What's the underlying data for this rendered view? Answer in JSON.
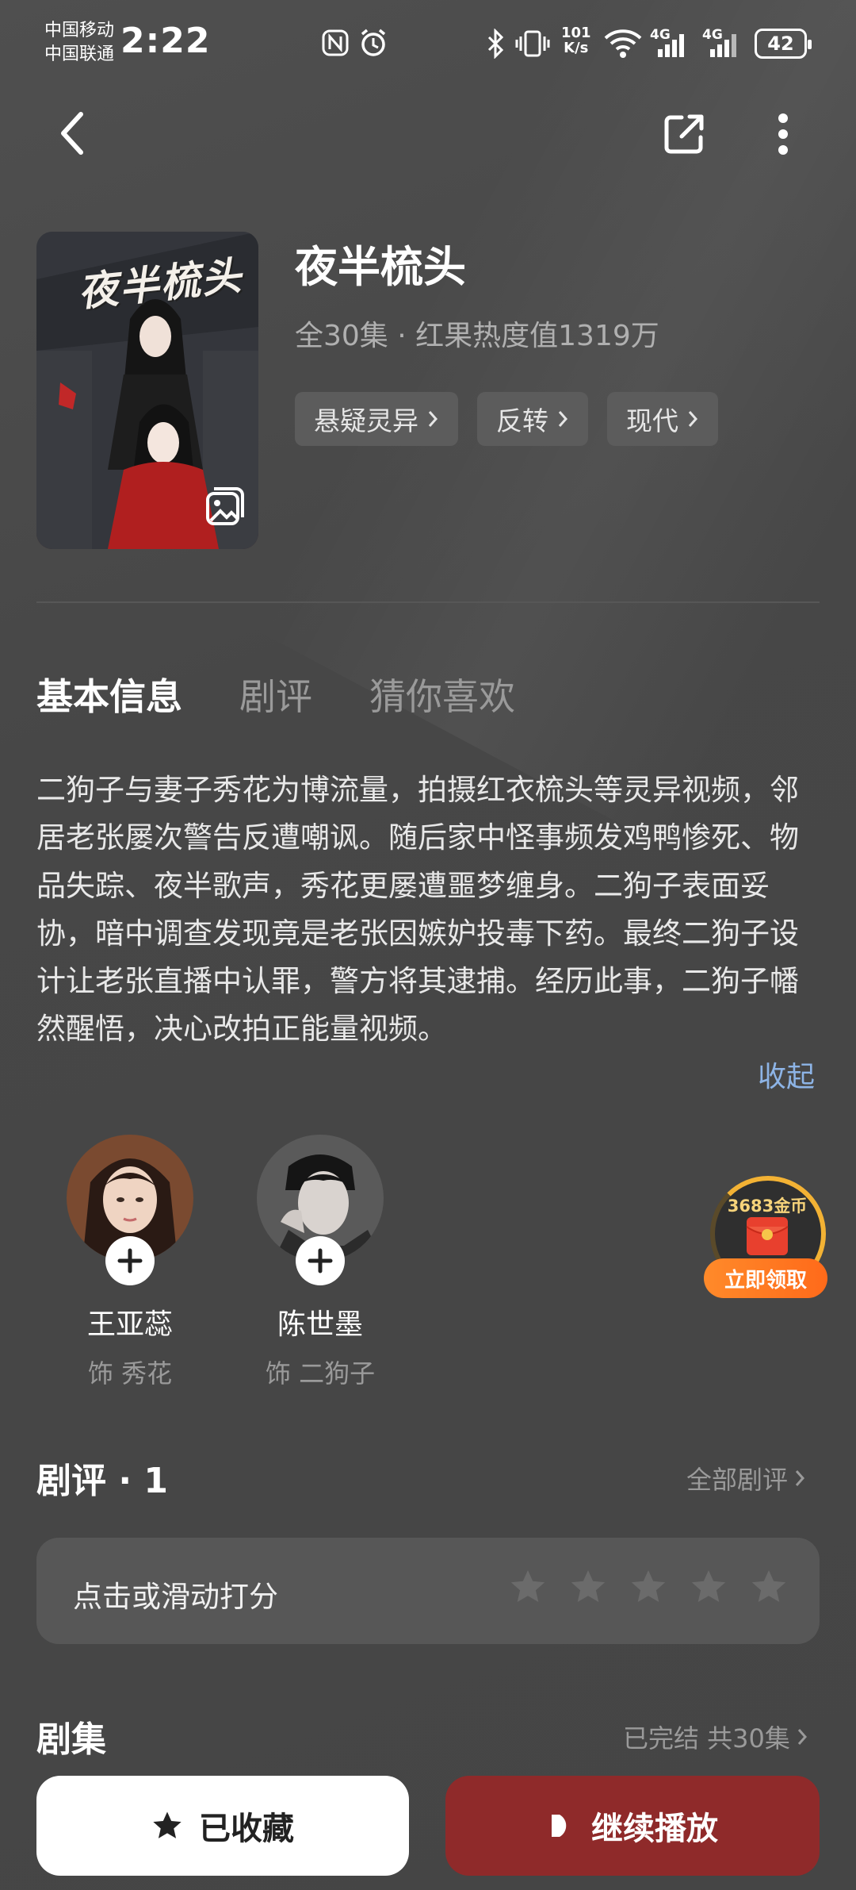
{
  "status_bar": {
    "carrier1": "中国移动",
    "carrier2": "中国联通",
    "time": "2:22",
    "speed_value": "101",
    "speed_unit": "K/s",
    "net1": "4G",
    "net2": "4G",
    "battery": "42"
  },
  "drama": {
    "title": "夜半梳头",
    "poster_title": "夜半梳头",
    "meta": "全30集 · 红果热度值1319万",
    "tags": [
      "悬疑灵异",
      "反转",
      "现代"
    ]
  },
  "tabs": [
    "基本信息",
    "剧评",
    "猜你喜欢"
  ],
  "synopsis": "二狗子与妻子秀花为博流量，拍摄红衣梳头等灵异视频，邻居老张屡次警告反遭嘲讽。随后家中怪事频发鸡鸭惨死、物品失踪、夜半歌声，秀花更屡遭噩梦缠身。二狗子表面妥协，暗中调查发现竟是老张因嫉妒投毒下药。最终二狗子设计让老张直播中认罪，警方将其逮捕。经历此事，二狗子幡然醒悟，决心改拍正能量视频。",
  "collapse_label": "收起",
  "cast": [
    {
      "name": "王亚蕊",
      "role": "饰 秀花"
    },
    {
      "name": "陈世墨",
      "role": "饰 二狗子"
    }
  ],
  "reward": {
    "amount": "3683金币",
    "button": "立即领取"
  },
  "reviews": {
    "heading": "剧评 · 1",
    "all_link": "全部剧评",
    "rating_prompt": "点击或滑动打分",
    "stars": 5
  },
  "episodes": {
    "heading": "剧集",
    "status": "已完结 共30集"
  },
  "actions": {
    "favorite": "已收藏",
    "play": "继续播放"
  }
}
